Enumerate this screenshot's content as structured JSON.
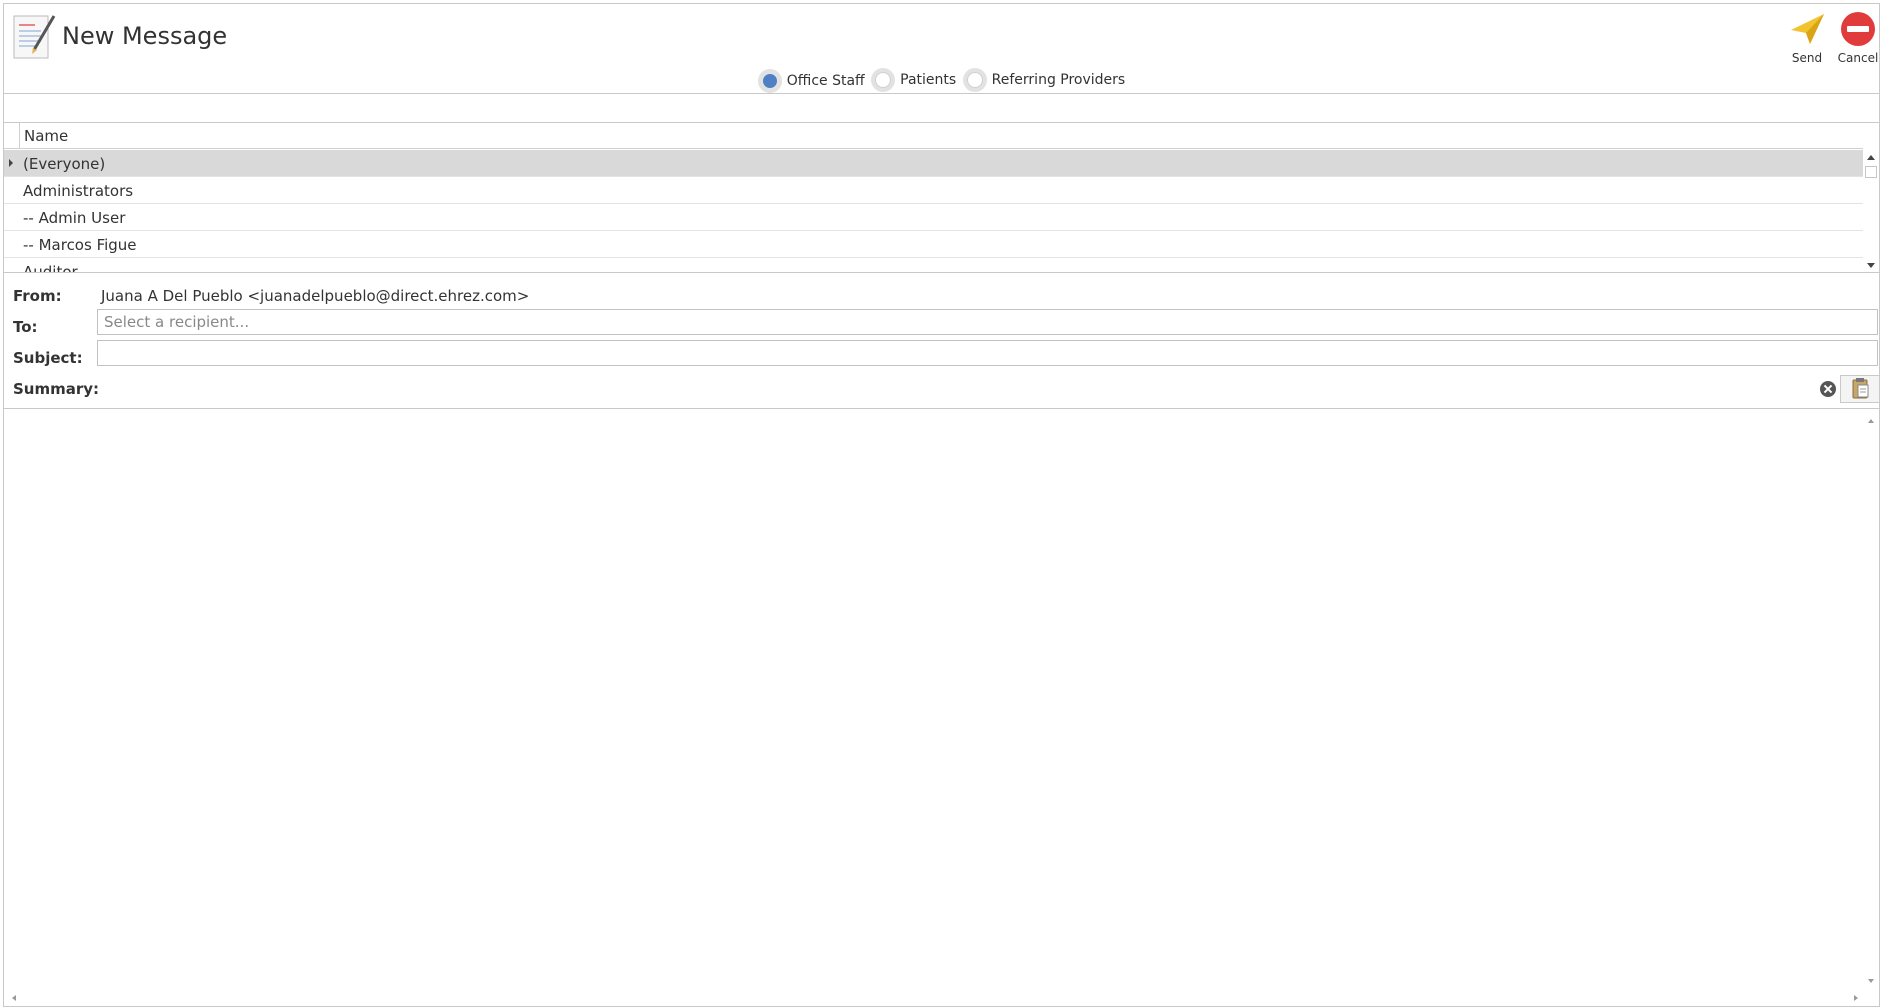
{
  "window": {
    "title": "New Message"
  },
  "actions": {
    "send_label": "Send",
    "cancel_label": "Cancel"
  },
  "recipient_types": [
    {
      "label": "Office Staff",
      "checked": true
    },
    {
      "label": "Patients",
      "checked": false
    },
    {
      "label": "Referring Providers",
      "checked": false
    }
  ],
  "grid": {
    "column_header": "Name",
    "rows": [
      "(Everyone)",
      "Administrators",
      "-- Admin User",
      "-- Marcos Figue",
      "Auditor"
    ],
    "selected_row": 0
  },
  "form": {
    "from_label": "From:",
    "from_value": "Juana A Del Pueblo <juanadelpueblo@direct.ehrez.com>",
    "to_label": "To:",
    "to_placeholder": "Select a recipient...",
    "subject_label": "Subject:",
    "subject_value": "",
    "summary_label": "Summary:"
  },
  "colors": {
    "radio_checked": "#4f7fc4",
    "send_icon": "#f2c230",
    "cancel_icon": "#e03c3c",
    "selected_row": "#d9d9d9"
  }
}
